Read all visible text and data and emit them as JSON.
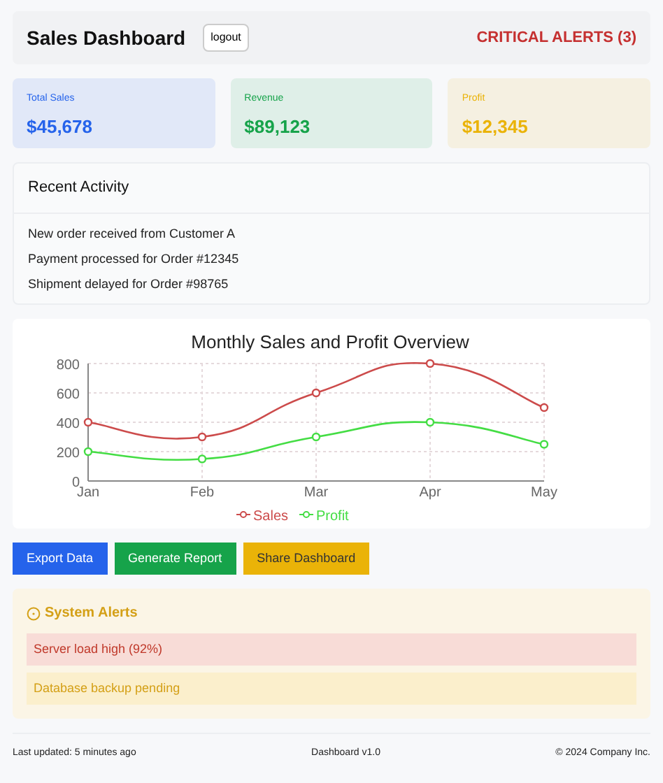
{
  "header": {
    "title": "Sales Dashboard",
    "logout": "logout",
    "alerts_badge": "CRITICAL ALERTS (3)"
  },
  "stats": [
    {
      "label": "Total Sales",
      "value": "$45,678",
      "color": "#2563eb"
    },
    {
      "label": "Revenue",
      "value": "$89,123",
      "color": "#16a34a"
    },
    {
      "label": "Profit",
      "value": "$12,345",
      "color": "#eab308"
    }
  ],
  "recent_activity": {
    "title": "Recent Activity",
    "items": [
      "New order received from Customer A",
      "Payment processed for Order #12345",
      "Shipment delayed for Order #98765"
    ]
  },
  "chart": {
    "chart_data": {
      "type": "line",
      "title": "Monthly Sales and Profit Overview",
      "categories": [
        "Jan",
        "Feb",
        "Mar",
        "Apr",
        "May"
      ],
      "series": [
        {
          "name": "Sales",
          "color": "#cc4b4b",
          "values": [
            400,
            300,
            600,
            800,
            500
          ],
          "marker": "circle"
        },
        {
          "name": "Profit",
          "color": "#44dd44",
          "values": [
            200,
            150,
            300,
            400,
            250
          ],
          "marker": "circle"
        }
      ],
      "ylim": [
        0,
        800
      ],
      "yticks": [
        0,
        200,
        400,
        600,
        800
      ],
      "grid": true,
      "legend": "bottom"
    }
  },
  "actions": [
    {
      "label": "Export Data",
      "color": "#2563eb"
    },
    {
      "label": "Generate Report",
      "color": "#16a34a"
    },
    {
      "label": "Share Dashboard",
      "color": "#eab308"
    }
  ],
  "system_alerts": {
    "title": "System Alerts",
    "items": [
      {
        "text": "Server load high (92%)",
        "kind": "error"
      },
      {
        "text": "Database backup pending",
        "kind": "warning"
      }
    ]
  },
  "footer": {
    "updated": "Last updated: 5 minutes ago",
    "version": "Dashboard v1.0",
    "copyright": "© 2024 Company Inc."
  }
}
